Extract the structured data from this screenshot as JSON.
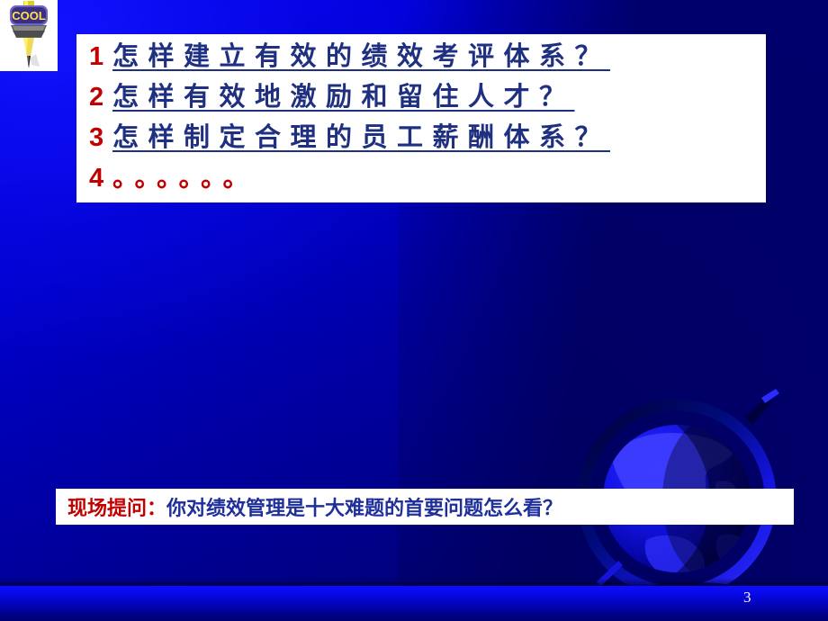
{
  "slide": {
    "page_number": "3",
    "background_color": "#0000c4",
    "accent_red": "#c00000",
    "accent_blue": "#1f3080"
  },
  "logo": {
    "name": "cool-logo",
    "text": "COOL",
    "badge_fill": "#4b3f9c",
    "text_fill": "#ffe14d"
  },
  "main_panel": {
    "lines": [
      {
        "number": "1",
        "text": "怎样建立有效的绩效考评体系？",
        "underline": true,
        "color": "#1f3080"
      },
      {
        "number": "2",
        "text": "怎样有效地激励和留住人才？",
        "underline": true,
        "color": "#1f3080"
      },
      {
        "number": "3",
        "text": "怎样制定合理的员工薪酬体系？",
        "underline": true,
        "color": "#1f3080"
      },
      {
        "number": "4",
        "text": "。。。。。。",
        "underline": false,
        "color": "#c00000"
      }
    ]
  },
  "question_panel": {
    "label": "现场提问：",
    "body": "你对绩效管理是十大难题的首要问题怎么看？"
  }
}
